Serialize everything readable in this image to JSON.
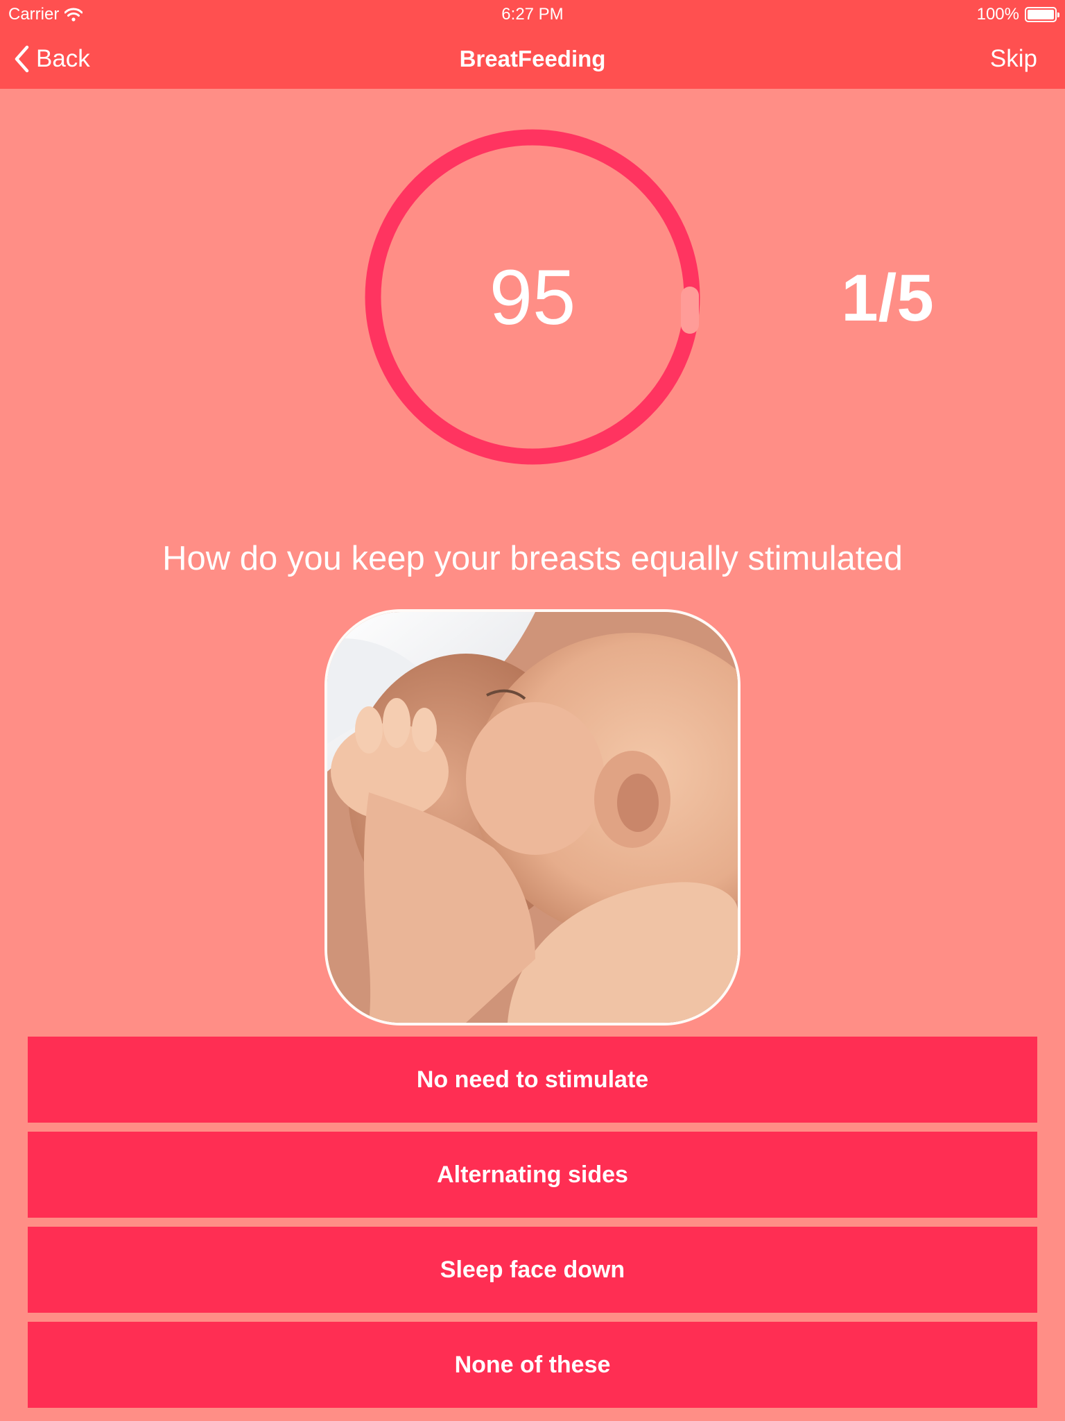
{
  "status_bar": {
    "carrier": "Carrier",
    "time": "6:27 PM",
    "battery": "100%"
  },
  "nav": {
    "back_label": "Back",
    "title": "BreatFeeding",
    "skip_label": "Skip"
  },
  "quiz": {
    "timer": "95",
    "progress": "1/5",
    "question": "How do you keep your breasts equally stimulated",
    "image": "photo-baby-breastfeeding",
    "answers": [
      "No need to stimulate",
      "Alternating sides",
      "Sleep face down",
      "None of these"
    ]
  },
  "colors": {
    "nav_bar": "#ff5050",
    "background": "#ff8e86",
    "accent": "#ff2e53"
  }
}
